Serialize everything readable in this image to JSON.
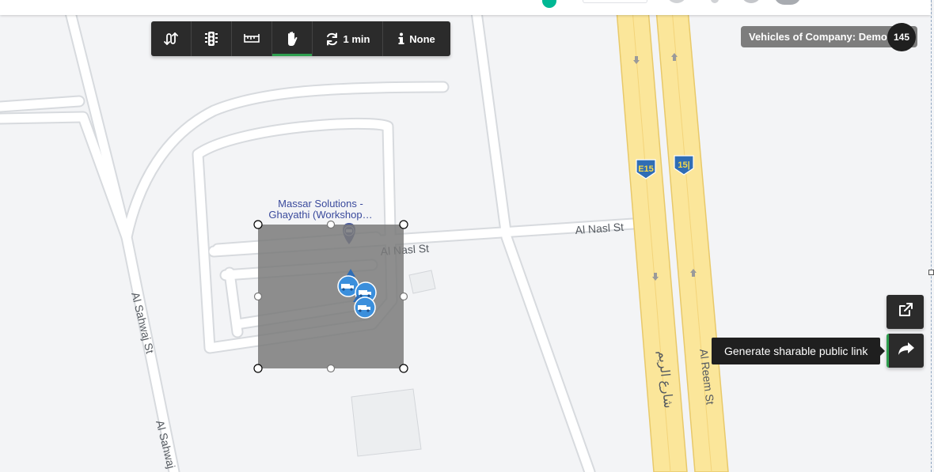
{
  "toolbar": {
    "tools": [
      {
        "name": "route-tool",
        "icon": "route-icon"
      },
      {
        "name": "traffic-tool",
        "icon": "traffic-light-icon"
      },
      {
        "name": "measure-tool",
        "icon": "ruler-icon"
      },
      {
        "name": "pan-tool",
        "icon": "hand-icon",
        "active": true
      },
      {
        "name": "refresh-tool",
        "icon": "refresh-icon",
        "label": "1 min"
      },
      {
        "name": "info-tool",
        "icon": "info-icon",
        "label": "None"
      }
    ],
    "refresh_label": "1 min",
    "info_label": "None"
  },
  "company": {
    "label": "Vehicles of Company: Demo",
    "count": "145"
  },
  "actions": {
    "share_tooltip": "Generate sharable public link",
    "open_icon": "external-link-icon",
    "share_icon": "share-icon"
  },
  "map": {
    "poi_name_line1": "Massar Solutions -",
    "poi_name_line2": "Ghayathi (Workshop…",
    "streets": {
      "nasl_main": "Al Nasl St",
      "nasl_east": "Al Nasl St",
      "sahwaj": "Al Sahwaj St",
      "sahwaj_lower": "Al Sahwaj",
      "reem_en": "Al Reem St",
      "reem_ar": "شارع الريم"
    },
    "shields": [
      "E15",
      "15|"
    ],
    "vehicle_count_in_selection": 3
  },
  "colors": {
    "toolbar_bg": "#2b2b2b",
    "active_accent": "#2e9e4f",
    "highway_fill": "#fbe69a",
    "shield_blue": "#2f6db5",
    "vehicle_blue": "#3b8fdc",
    "selection_fill": "#7a7a7a"
  }
}
